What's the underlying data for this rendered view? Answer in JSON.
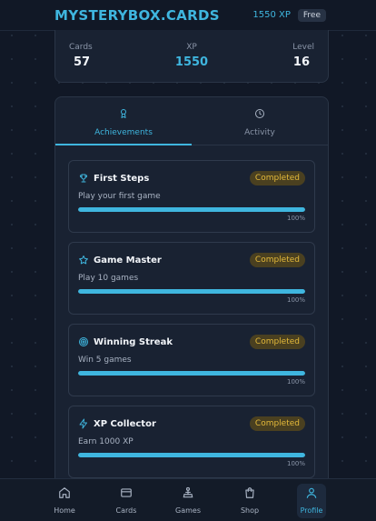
{
  "header": {
    "brand": "MYSTERYBOX.CARDS",
    "xp": "1550 XP",
    "plan": "Free"
  },
  "stats": [
    {
      "label": "Cards",
      "value": "57"
    },
    {
      "label": "XP",
      "value": "1550"
    },
    {
      "label": "Level",
      "value": "16"
    }
  ],
  "tabs": [
    {
      "label": "Achievements",
      "icon": "medal-icon",
      "active": true
    },
    {
      "label": "Activity",
      "icon": "clock-icon",
      "active": false
    }
  ],
  "achievements": [
    {
      "title": "First Steps",
      "icon": "trophy-icon",
      "status": "Completed",
      "description": "Play your first game",
      "progress": 1.0,
      "progress_label": "100%"
    },
    {
      "title": "Game Master",
      "icon": "star-icon",
      "status": "Completed",
      "description": "Play 10 games",
      "progress": 1.0,
      "progress_label": "100%"
    },
    {
      "title": "Winning Streak",
      "icon": "target-icon",
      "status": "Completed",
      "description": "Win 5 games",
      "progress": 1.0,
      "progress_label": "100%"
    },
    {
      "title": "XP Collector",
      "icon": "lightning-icon",
      "status": "Completed",
      "description": "Earn 1000 XP",
      "progress": 1.0,
      "progress_label": "100%"
    }
  ],
  "nav": [
    {
      "label": "Home",
      "icon": "home-icon",
      "active": false
    },
    {
      "label": "Cards",
      "icon": "card-icon",
      "active": false
    },
    {
      "label": "Games",
      "icon": "joystick-icon",
      "active": false
    },
    {
      "label": "Shop",
      "icon": "shopping-bag-icon",
      "active": false
    },
    {
      "label": "Profile",
      "icon": "user-icon",
      "active": true
    }
  ],
  "colors": {
    "accent": "#3fb6df",
    "badge_text": "#e4b93a",
    "badge_bg": "#4a4020",
    "background": "#111826",
    "card": "#192232"
  }
}
